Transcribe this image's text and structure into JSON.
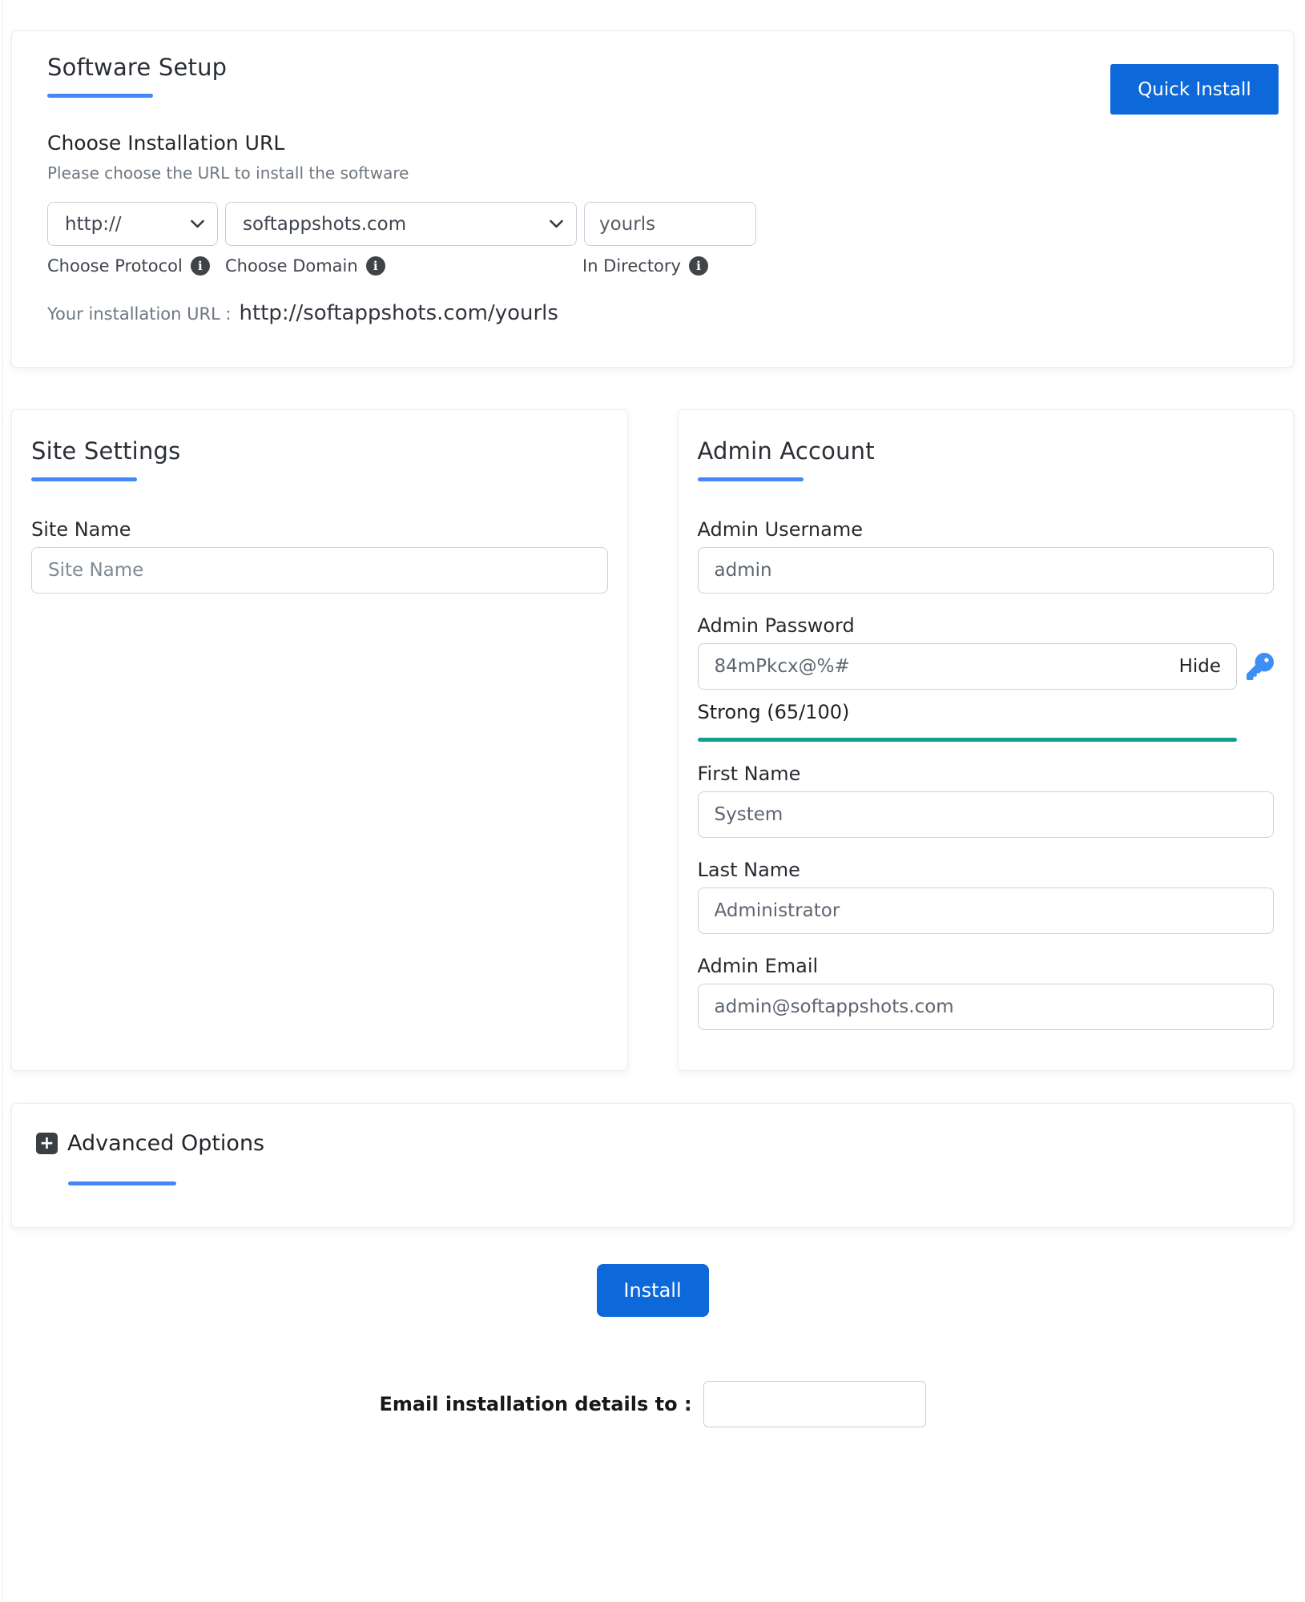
{
  "colors": {
    "primary_button_blue": "#0d68d9",
    "heading_underline_blue": "#4189f5",
    "strength_bar_teal": "#10a08d",
    "key_icon_blue": "#3f8ef6",
    "info_badge_dark": "#3f4449"
  },
  "icons": {
    "plus_glyph": "+",
    "info_glyph": "i"
  },
  "software_setup": {
    "title": "Software Setup",
    "quick_install_label": "Quick Install",
    "section_title": "Choose Installation URL",
    "section_subtitle": "Please choose the URL to install the software",
    "protocol": {
      "value": "http://",
      "label": "Choose Protocol"
    },
    "domain": {
      "value": "softappshots.com",
      "label": "Choose Domain"
    },
    "directory": {
      "value": "yourls",
      "label": "In Directory"
    },
    "installation_url_label": "Your installation URL :",
    "installation_url_value": "http://softappshots.com/yourls"
  },
  "site_settings": {
    "title": "Site Settings",
    "site_name_label": "Site Name",
    "site_name_placeholder": "Site Name"
  },
  "admin_account": {
    "title": "Admin Account",
    "username_label": "Admin Username",
    "username_value": "admin",
    "password_label": "Admin Password",
    "password_value": "84mPkcx@%#",
    "hide_label": "Hide",
    "strength_text": "Strong (65/100)",
    "strength_score": 65,
    "strength_max": 100,
    "first_name_label": "First Name",
    "first_name_value": "System",
    "last_name_label": "Last Name",
    "last_name_value": "Administrator",
    "email_label": "Admin Email",
    "email_value": "admin@softappshots.com"
  },
  "advanced_options": {
    "title": "Advanced Options"
  },
  "footer": {
    "install_label": "Install",
    "email_details_label": "Email installation details to :",
    "email_details_value": ""
  }
}
